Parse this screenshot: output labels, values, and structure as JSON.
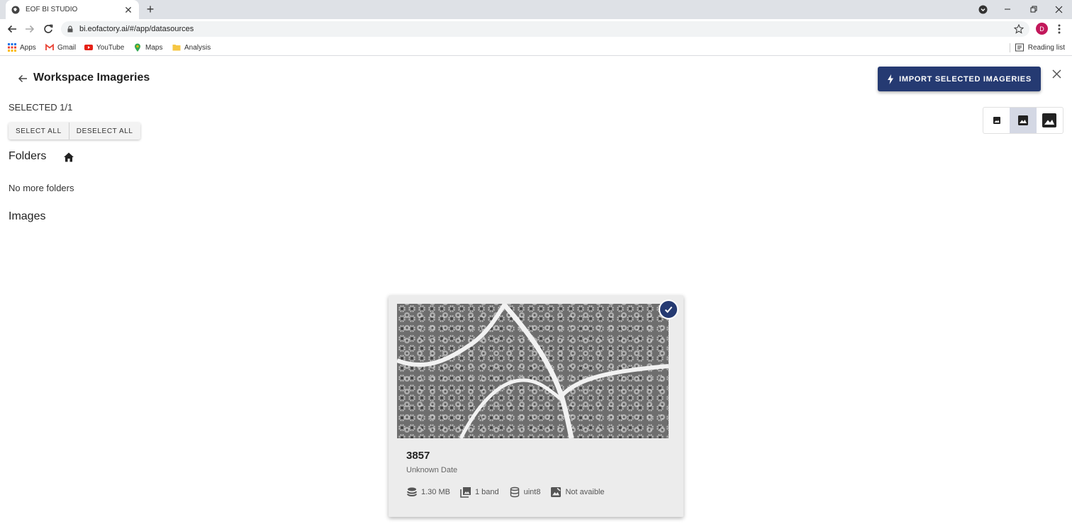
{
  "browser": {
    "tab_title": "EOF BI STUDIO",
    "tab_close": "✕",
    "new_tab": "+",
    "url": "bi.eofactory.ai/#/app/datasources",
    "profile_initial": "D",
    "bookmarks": [
      {
        "label": "Apps",
        "icon": "apps-grid-icon"
      },
      {
        "label": "Gmail",
        "icon": "gmail-icon"
      },
      {
        "label": "YouTube",
        "icon": "youtube-icon"
      },
      {
        "label": "Maps",
        "icon": "maps-pin-icon"
      },
      {
        "label": "Analysis",
        "icon": "folder-icon"
      }
    ],
    "reading_list": "Reading list"
  },
  "header": {
    "title": "Workspace Imageries",
    "import_label": "IMPORT SELECTED IMAGERIES"
  },
  "selection": {
    "count_text": "SELECTED 1/1",
    "select_all": "SELECT ALL",
    "deselect_all": "DESELECT ALL"
  },
  "folders": {
    "title": "Folders",
    "empty_text": "No more folders"
  },
  "images": {
    "title": "Images",
    "items": [
      {
        "name": "3857",
        "date": "Unknown Date",
        "size": "1.30 MB",
        "bands": "1 band",
        "dtype": "uint8",
        "preview": "Not avaible",
        "selected": true
      }
    ]
  },
  "colors": {
    "accent": "#253a72",
    "profile": "#c2185b"
  }
}
